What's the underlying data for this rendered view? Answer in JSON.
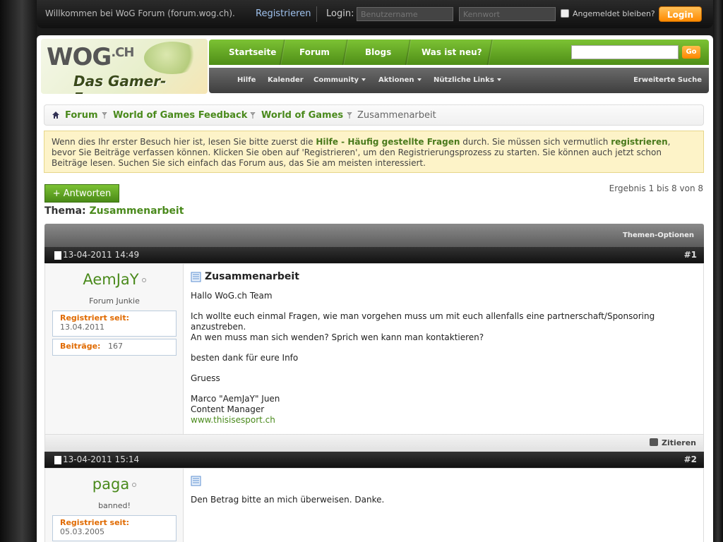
{
  "topbar": {
    "welcome": "Willkommen bei WoG Forum (forum.wog.ch).",
    "register": "Registrieren",
    "login_label": "Login:",
    "username_placeholder": "Benutzername",
    "password_placeholder": "Kennwort",
    "remember": "Angemeldet bleiben?",
    "login_button": "Login"
  },
  "logo": {
    "line1": "WOG",
    "line1_suffix": ".CH",
    "line2": "Das Gamer-Forum"
  },
  "nav": {
    "items": [
      "Startseite",
      "Forum",
      "Blogs",
      "Was ist neu?"
    ],
    "go": "Go"
  },
  "subnav": {
    "items": [
      "Hilfe",
      "Kalender",
      "Community",
      "Aktionen",
      "Nützliche Links"
    ],
    "advanced_search": "Erweiterte Suche"
  },
  "breadcrumb": {
    "items": [
      "Forum",
      "World of Games Feedback",
      "World of Games"
    ],
    "current": "Zusammenarbeit"
  },
  "notice": {
    "t1": "Wenn dies Ihr erster Besuch hier ist, lesen Sie bitte zuerst die ",
    "faq": "Hilfe - Häufig gestellte Fragen",
    "t2": " durch. Sie müssen sich vermutlich ",
    "register": "registrieren",
    "t3": ", bevor Sie Beiträge verfassen können. Klicken Sie oben auf 'Registrieren', um den Registrierungsprozess zu starten. Sie können auch jetzt schon Beiträge lesen. Suchen Sie sich einfach das Forum aus, das Sie am meisten interessiert."
  },
  "reply_button": "+ Antworten",
  "results": "Ergebnis 1 bis 8 von 8",
  "thread": {
    "label": "Thema:",
    "name": "Zusammenarbeit",
    "options": "Themen-Optionen"
  },
  "posts": [
    {
      "date": "13-04-2011 14:49",
      "num": "#1",
      "user": "AemJaY",
      "user_title": "Forum Junkie",
      "registered_label": "Registriert seit:",
      "registered": "13.04.2011",
      "posts_label": "Beiträge:",
      "posts": "167",
      "title": "Zusammenarbeit",
      "body": [
        "Hallo WoG.ch Team",
        "Ich wollte euch einmal Fragen, wie man vorgehen muss um mit euch allenfalls eine partnerschaft/Sponsoring anzustreben.",
        "An wen muss man sich wenden? Sprich wen kann man kontaktieren?",
        "besten dank für eure Info",
        "Gruess",
        "Marco \"AemJaY\" Juen",
        "Content Manager"
      ],
      "link": "www.thisisesport.ch",
      "quote": "Zitieren"
    },
    {
      "date": "13-04-2011 15:14",
      "num": "#2",
      "user": "paga",
      "user_title": "banned!",
      "registered_label": "Registriert seit:",
      "registered": "05.03.2005",
      "body": [
        "Den Betrag bitte an mich überweisen. Danke."
      ]
    }
  ],
  "colors": {
    "accent_green": "#4a8a1c",
    "orange": "#ff8a00",
    "notice_bg": "#fdf3c8"
  }
}
